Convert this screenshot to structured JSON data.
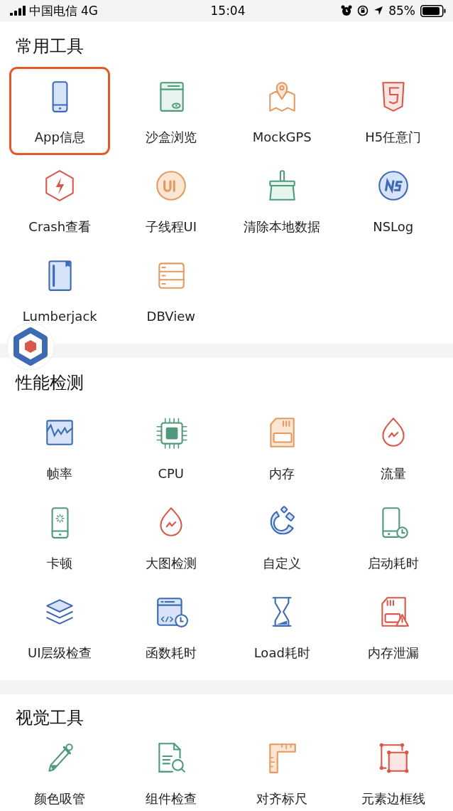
{
  "status_bar": {
    "carrier": "中国电信",
    "network": "4G",
    "time": "15:04",
    "battery": "85%"
  },
  "sections": [
    {
      "title": "常用工具",
      "items": [
        {
          "label": "App信息",
          "selected": true
        },
        {
          "label": "沙盒浏览",
          "selected": false
        },
        {
          "label": "MockGPS",
          "selected": false
        },
        {
          "label": "H5任意门",
          "selected": false
        },
        {
          "label": "Crash查看",
          "selected": false
        },
        {
          "label": "子线程UI",
          "selected": false
        },
        {
          "label": "清除本地数据",
          "selected": false
        },
        {
          "label": "NSLog",
          "selected": false
        },
        {
          "label": "Lumberjack",
          "selected": false
        },
        {
          "label": "DBView",
          "selected": false
        }
      ]
    },
    {
      "title": "性能检测",
      "items": [
        {
          "label": "帧率",
          "selected": false
        },
        {
          "label": "CPU",
          "selected": false
        },
        {
          "label": "内存",
          "selected": false
        },
        {
          "label": "流量",
          "selected": false
        },
        {
          "label": "卡顿",
          "selected": false
        },
        {
          "label": "大图检测",
          "selected": false
        },
        {
          "label": "自定义",
          "selected": false
        },
        {
          "label": "启动耗时",
          "selected": false
        },
        {
          "label": "UI层级检查",
          "selected": false
        },
        {
          "label": "函数耗时",
          "selected": false
        },
        {
          "label": "Load耗时",
          "selected": false
        },
        {
          "label": "内存泄漏",
          "selected": false
        }
      ]
    },
    {
      "title": "视觉工具",
      "items": [
        {
          "label": "颜色吸管",
          "selected": false
        },
        {
          "label": "组件检查",
          "selected": false
        },
        {
          "label": "对齐标尺",
          "selected": false
        },
        {
          "label": "元素边框线",
          "selected": false
        }
      ]
    }
  ]
}
